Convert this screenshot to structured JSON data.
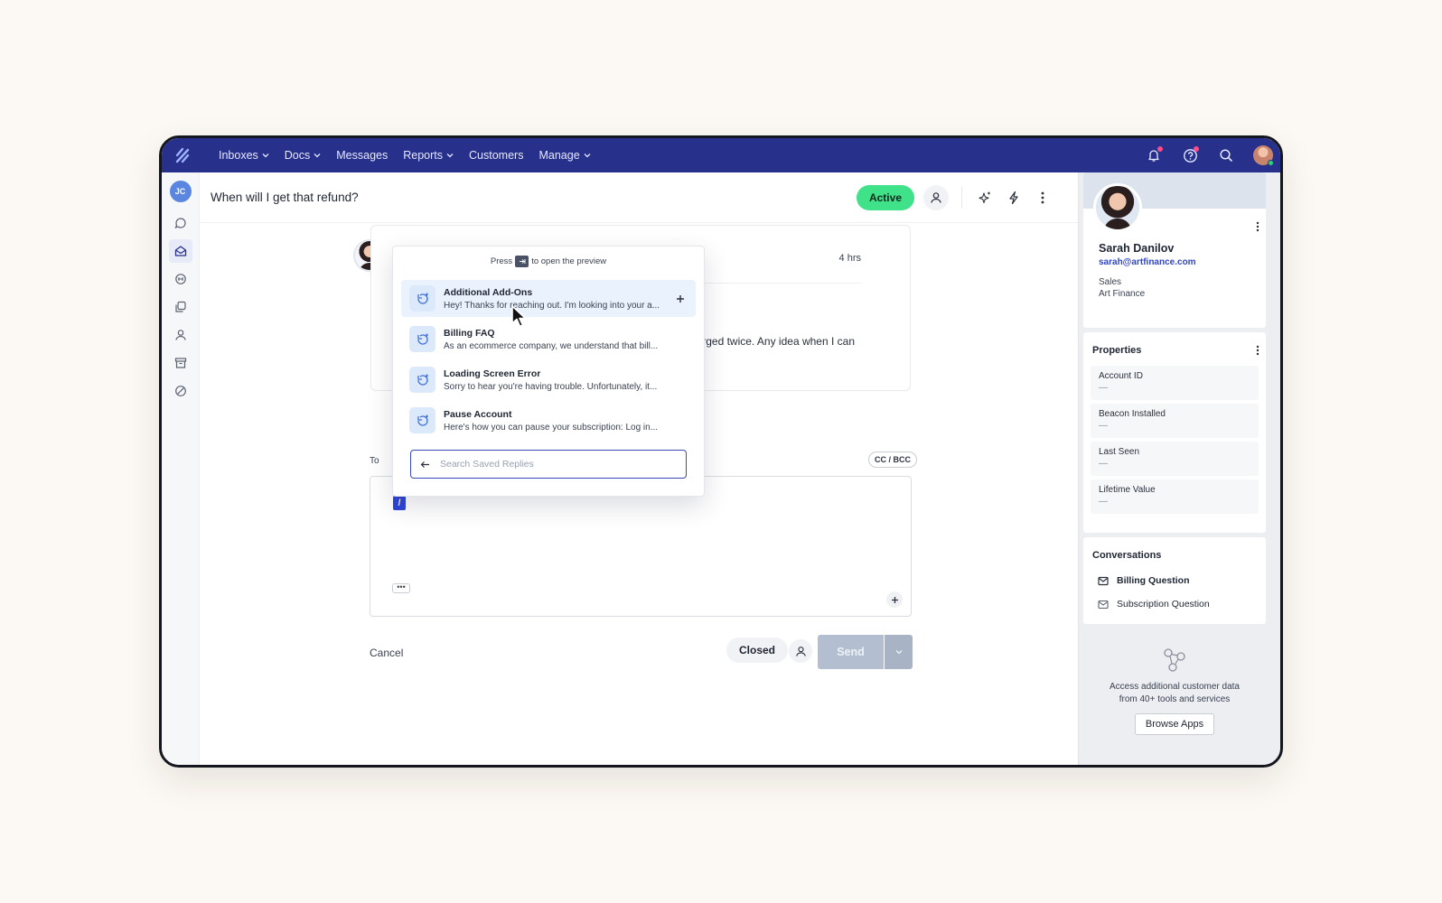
{
  "nav": {
    "items": [
      {
        "label": "Inboxes",
        "dropdown": true
      },
      {
        "label": "Docs",
        "dropdown": true
      },
      {
        "label": "Messages",
        "dropdown": false
      },
      {
        "label": "Reports",
        "dropdown": true
      },
      {
        "label": "Customers",
        "dropdown": false
      },
      {
        "label": "Manage",
        "dropdown": true
      }
    ],
    "icons": [
      "bell-icon",
      "help-icon",
      "search-icon"
    ],
    "accent": "#27308a",
    "notification_dot_color": "#ff4a8b"
  },
  "rail": {
    "user_initials": "JC",
    "icons": [
      "chat-icon",
      "inbox-icon",
      "handshake-icon",
      "copy-icon",
      "person-icon",
      "archive-icon",
      "spam-icon"
    ]
  },
  "conversation": {
    "title": "When will I get that refund?",
    "status": "Active",
    "status_color": "#3fe189",
    "message_time": "4 hrs",
    "message_excerpt": "charged twice. Any idea when I can"
  },
  "saved_replies": {
    "hint_before": "Press",
    "hint_after": "to open the preview",
    "items": [
      {
        "title": "Additional Add-Ons",
        "snippet": "Hey! Thanks for reaching out. I'm looking into your a..."
      },
      {
        "title": "Billing FAQ",
        "snippet": "As an ecommerce company, we understand that bill..."
      },
      {
        "title": "Loading Screen Error",
        "snippet": "Sorry to hear you're having trouble. Unfortunately, it..."
      },
      {
        "title": "Pause Account",
        "snippet": "Here's how you can pause your subscription: Log in..."
      }
    ],
    "search_placeholder": "Search Saved Replies"
  },
  "composer": {
    "to_label": "To",
    "cc_bcc": "CC / BCC",
    "slash": "/",
    "more": "•••",
    "cancel": "Cancel",
    "closed": "Closed",
    "send": "Send"
  },
  "customer": {
    "name": "Sarah Danilov",
    "email": "sarah@artfinance.com",
    "department": "Sales",
    "company": "Art Finance"
  },
  "properties": {
    "title": "Properties",
    "items": [
      {
        "label": "Account ID",
        "value": "—"
      },
      {
        "label": "Beacon Installed",
        "value": "—"
      },
      {
        "label": "Last Seen",
        "value": "—"
      },
      {
        "label": "Lifetime Value",
        "value": "—"
      }
    ]
  },
  "conversations_panel": {
    "title": "Conversations",
    "items": [
      {
        "label": "Billing Question",
        "icon": "mail-open-icon"
      },
      {
        "label": "Subscription Question",
        "icon": "mail-icon"
      }
    ]
  },
  "apps": {
    "text_line1": "Access additional customer data",
    "text_line2": "from 40+ tools and services",
    "button": "Browse Apps"
  }
}
